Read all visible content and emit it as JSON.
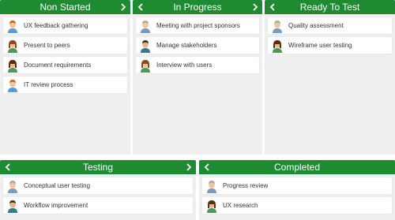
{
  "columns": [
    {
      "title": "Non Started",
      "has_left": false,
      "has_right": true,
      "cards": [
        {
          "label": "UX feedback gathering",
          "avatar": "man-orange-hair-avatar"
        },
        {
          "label": "Present to peers",
          "avatar": "woman-brown-hair-avatar"
        },
        {
          "label": "Document requirements",
          "avatar": "woman-dark-hair-avatar"
        },
        {
          "label": "IT review process",
          "avatar": "man-orange-hair-avatar"
        }
      ]
    },
    {
      "title": "In Progress",
      "has_left": true,
      "has_right": true,
      "cards": [
        {
          "label": "Meeting with project sponsors",
          "avatar": "man-gray-hair-avatar"
        },
        {
          "label": "Manage stakeholders",
          "avatar": "man-dark-hair-avatar"
        },
        {
          "label": "Interview with users",
          "avatar": "woman-brown-hair-avatar"
        }
      ]
    },
    {
      "title": "Ready To Test",
      "has_left": true,
      "has_right": false,
      "cards": [
        {
          "label": "Quality assessment",
          "avatar": "man-gray-hair-avatar"
        },
        {
          "label": "Wireframe user testing",
          "avatar": "woman-dark-hair-avatar"
        }
      ]
    },
    {
      "title": "Testing",
      "has_left": true,
      "has_right": true,
      "cards": [
        {
          "label": "Conceptual user testing",
          "avatar": "man-gray-hair-avatar"
        },
        {
          "label": "Workflow improvement",
          "avatar": "man-dark-hair-avatar"
        }
      ]
    },
    {
      "title": "Completed",
      "has_left": true,
      "has_right": false,
      "cards": [
        {
          "label": "Progress review",
          "avatar": "man-gray-hair-avatar"
        },
        {
          "label": "UX research",
          "avatar": "woman-dark-hair-avatar"
        }
      ]
    }
  ],
  "colors": {
    "header": "#1e8a32",
    "column_bg": "#efefef",
    "card_bg": "#ffffff",
    "text": "#333333"
  },
  "icons": {
    "left": "chevron-left-icon",
    "right": "chevron-right-icon"
  }
}
